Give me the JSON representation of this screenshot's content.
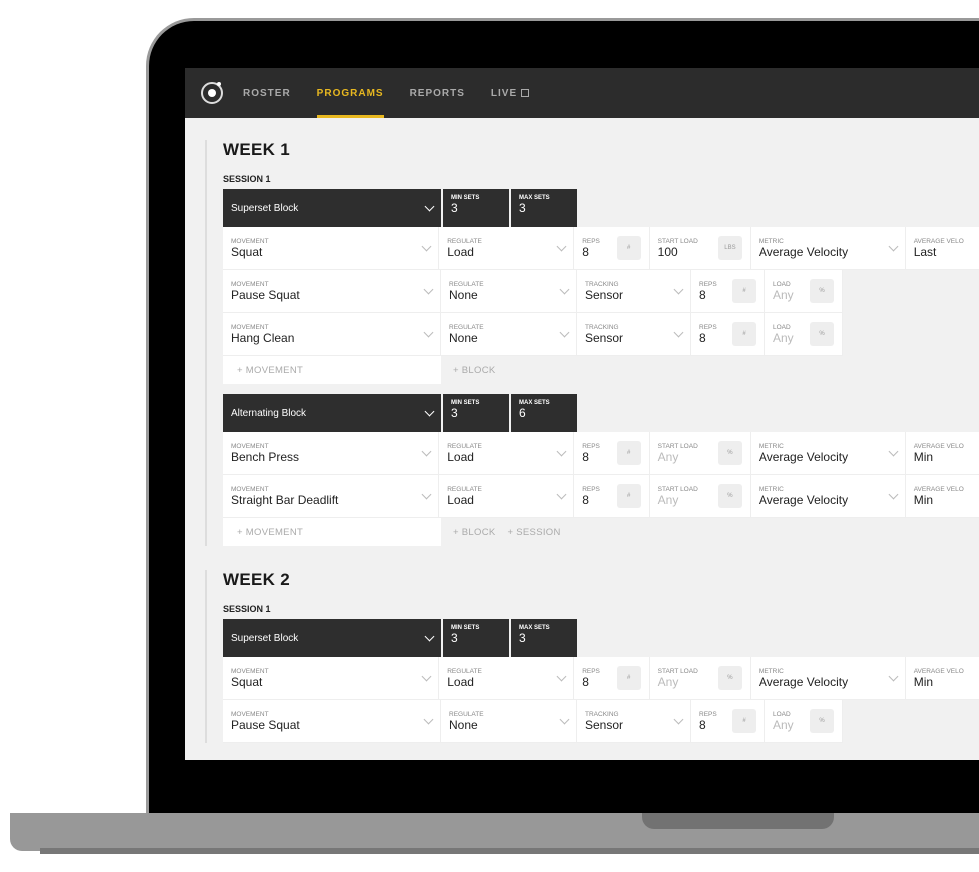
{
  "nav": {
    "items": [
      {
        "label": "ROSTER"
      },
      {
        "label": "PROGRAMS",
        "active": true
      },
      {
        "label": "REPORTS"
      },
      {
        "label": "LIVE"
      }
    ],
    "accent": "#e8b820"
  },
  "labels": {
    "movement": "MOVEMENT",
    "regulate": "REGULATE",
    "reps": "REPS",
    "start_load": "START LOAD",
    "metric": "METRIC",
    "average_velocity": "AVERAGE VELO",
    "tracking": "TRACKING",
    "load": "LOAD",
    "min_sets": "MIN SETS",
    "max_sets": "MAX SETS",
    "add_movement": "+  MOVEMENT",
    "add_block": "+ BLOCK",
    "add_session": "+ SESSION",
    "hash": "#",
    "lbs": "LBS",
    "pct": "%"
  },
  "weeks": [
    {
      "title": "WEEK 1",
      "session": "SESSION 1",
      "blocks": [
        {
          "name": "Superset Block",
          "min_sets": "3",
          "max_sets": "3",
          "rows": [
            {
              "movement": "Squat",
              "regulate": "Load",
              "reps": "8",
              "start_load": "100",
              "unit": "LBS",
              "metric": "Average Velocity",
              "avg": "Last"
            },
            {
              "movement": "Pause Squat",
              "regulate": "None",
              "tracking": "Sensor",
              "reps": "8",
              "load": "Any"
            },
            {
              "movement": "Hang Clean",
              "regulate": "None",
              "tracking": "Sensor",
              "reps": "8",
              "load": "Any"
            }
          ]
        },
        {
          "name": "Alternating Block",
          "min_sets": "3",
          "max_sets": "6",
          "rows": [
            {
              "movement": "Bench Press",
              "regulate": "Load",
              "reps": "8",
              "start_load": "Any",
              "unit": "%",
              "metric": "Average Velocity",
              "avg": "Min"
            },
            {
              "movement": "Straight Bar Deadlift",
              "regulate": "Load",
              "reps": "8",
              "start_load": "Any",
              "unit": "%",
              "metric": "Average Velocity",
              "avg": "Min"
            }
          ]
        }
      ]
    },
    {
      "title": "WEEK 2",
      "session": "SESSION 1",
      "blocks": [
        {
          "name": "Superset Block",
          "min_sets": "3",
          "max_sets": "3",
          "rows": [
            {
              "movement": "Squat",
              "regulate": "Load",
              "reps": "8",
              "start_load": "Any",
              "unit": "%",
              "metric": "Average Velocity",
              "avg": "Min"
            },
            {
              "movement": "Pause Squat",
              "regulate": "None",
              "tracking": "Sensor",
              "reps": "8",
              "load": "Any"
            }
          ]
        }
      ]
    }
  ]
}
